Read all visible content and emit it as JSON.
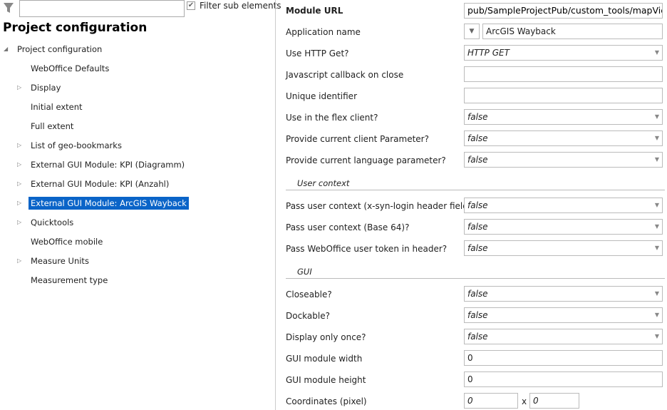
{
  "filter": {
    "value": "",
    "checkbox_label": "Filter sub elements",
    "checked": true
  },
  "title": "Project configuration",
  "tree": [
    {
      "label": "Project configuration",
      "level": 0,
      "expander": "expanded"
    },
    {
      "label": "WebOffice Defaults",
      "level": 1,
      "expander": ""
    },
    {
      "label": "Display",
      "level": 1,
      "expander": "collapsed"
    },
    {
      "label": "Initial extent",
      "level": 1,
      "expander": ""
    },
    {
      "label": "Full extent",
      "level": 1,
      "expander": ""
    },
    {
      "label": "List of geo-bookmarks",
      "level": 1,
      "expander": "collapsed"
    },
    {
      "label": "External GUI Module: KPI (Diagramm)",
      "level": 1,
      "expander": "collapsed"
    },
    {
      "label": "External GUI Module: KPI (Anzahl)",
      "level": 1,
      "expander": "collapsed"
    },
    {
      "label": "External GUI Module: ArcGIS Wayback",
      "level": 1,
      "expander": "collapsed",
      "selected": true
    },
    {
      "label": "Quicktools",
      "level": 1,
      "expander": "collapsed"
    },
    {
      "label": "WebOffice mobile",
      "level": 1,
      "expander": ""
    },
    {
      "label": "Measure Units",
      "level": 1,
      "expander": "collapsed"
    },
    {
      "label": "Measurement type",
      "level": 1,
      "expander": ""
    }
  ],
  "props": {
    "module_url": {
      "label": "Module URL",
      "value": "pub/SampleProjectPub/custom_tools/mapViewSlid"
    },
    "app_name": {
      "label": "Application name",
      "value": "ArcGIS Wayback"
    },
    "rows1": [
      {
        "label": "Use HTTP Get?",
        "value": "HTTP GET",
        "type": "select"
      },
      {
        "label": "Javascript callback on close",
        "value": "",
        "type": "text"
      },
      {
        "label": "Unique identifier",
        "value": "",
        "type": "text"
      },
      {
        "label": "Use in the flex client?",
        "value": "false",
        "type": "select"
      },
      {
        "label": "Provide current client Parameter?",
        "value": "false",
        "type": "select"
      },
      {
        "label": "Provide current language parameter?",
        "value": "false",
        "type": "select"
      }
    ],
    "section_user": "User context",
    "rows2": [
      {
        "label": "Pass user context (x-syn-login header field)?",
        "value": "false",
        "type": "select"
      },
      {
        "label": "Pass user context (Base 64)?",
        "value": "false",
        "type": "select"
      },
      {
        "label": "Pass WebOffice user token in header?",
        "value": "false",
        "type": "select"
      }
    ],
    "section_gui": "GUI",
    "rows3": [
      {
        "label": "Closeable?",
        "value": "false",
        "type": "select"
      },
      {
        "label": "Dockable?",
        "value": "false",
        "type": "select"
      },
      {
        "label": "Display only once?",
        "value": "false",
        "type": "select"
      },
      {
        "label": "GUI module width",
        "value": "0",
        "type": "text"
      },
      {
        "label": "GUI module height",
        "value": "0",
        "type": "text"
      }
    ],
    "coords": {
      "label": "Coordinates (pixel)",
      "x": "0",
      "separator": "x",
      "y": "0"
    }
  }
}
